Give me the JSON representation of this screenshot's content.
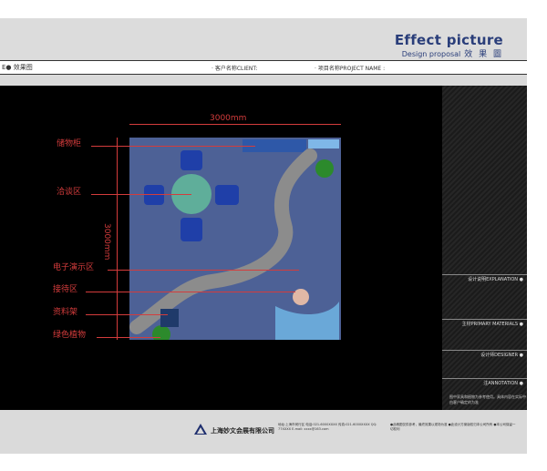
{
  "header": {
    "title_main": "Effect picture",
    "title_sub": "Design proposal",
    "title_cn": "效 果 圖"
  },
  "infobar": {
    "page_label": "E● 效果图",
    "client_label": "· 客户名称CLIENT:",
    "project_label": "· 项目名称PROJECT NAME :"
  },
  "plan": {
    "dim_width": "3000mm",
    "dim_height": "3000mm",
    "callouts": [
      "储物柜",
      "洽谈区",
      "电子演示区",
      "接待区",
      "资料架",
      "绿色植物"
    ]
  },
  "sidebar": {
    "explanation": "设计说明EXPLANATION ●",
    "materials": "主材PRIMARY MATERIALS ●",
    "designer": "设计师DESIGNER ●",
    "annotation": "注ANNOTATION ●",
    "annotation_text": "图中家具和植物为参考使用。具体内容在实际中由客户确定的为准"
  },
  "footer": {
    "company_name": "上海妙文会展有限公司",
    "address": "地址:上海市闵行区 电话:021-6000XXXX 传真:021-6000XXXX QQ: 77XXXX E-mail: xxxx@163.com",
    "note": "●此稿图仅供参考，最终效果以现场为准 ●此设计方案版权归本公司所有 ●本公司保留一切权利"
  },
  "colors": {
    "accent_red": "#d43c3c",
    "title_blue": "#2a3e7a",
    "floor_blue": "#4a5d91"
  }
}
